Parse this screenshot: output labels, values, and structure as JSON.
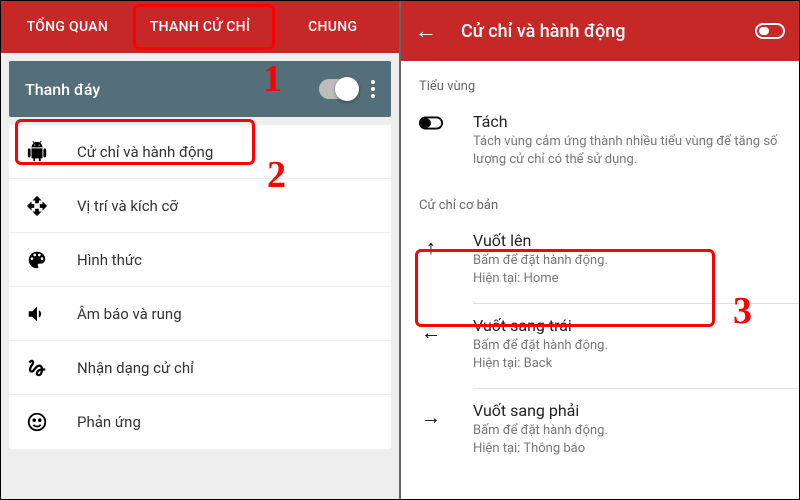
{
  "left": {
    "tabs": [
      "TỔNG QUAN",
      "THANH CỬ CHỈ",
      "CHUNG"
    ],
    "bottom_bar_label": "Thanh đáy",
    "rows": [
      {
        "icon": "android",
        "label": "Cử chỉ và hành động"
      },
      {
        "icon": "move",
        "label": "Vị trí và kích cỡ"
      },
      {
        "icon": "palette",
        "label": "Hình thức"
      },
      {
        "icon": "volume",
        "label": "Âm báo và rung"
      },
      {
        "icon": "gesture",
        "label": "Nhận dạng cử chỉ"
      },
      {
        "icon": "smile",
        "label": "Phản ứng"
      }
    ]
  },
  "right": {
    "title": "Cử chỉ và hành động",
    "section_subzones": "Tiểu vùng",
    "split": {
      "title": "Tách",
      "desc": "Tách vùng cảm ứng thành nhiều tiểu vùng để tăng số lượng cử chỉ có thể sử dụng."
    },
    "section_basic": "Cử chỉ cơ bản",
    "gestures": [
      {
        "icon": "↑",
        "title": "Vuốt lên",
        "sub1": "Bấm để đặt hành động.",
        "sub2": "Hiện tại: Home"
      },
      {
        "icon": "←",
        "title": "Vuốt sang trái",
        "sub1": "Bấm để đặt hành động.",
        "sub2": "Hiện tại: Back"
      },
      {
        "icon": "→",
        "title": "Vuốt sang phải",
        "sub1": "Bấm để đặt hành động.",
        "sub2": "Hiện tại: Thông báo"
      }
    ]
  },
  "annotations": {
    "n1": "1",
    "n2": "2",
    "n3": "3"
  }
}
